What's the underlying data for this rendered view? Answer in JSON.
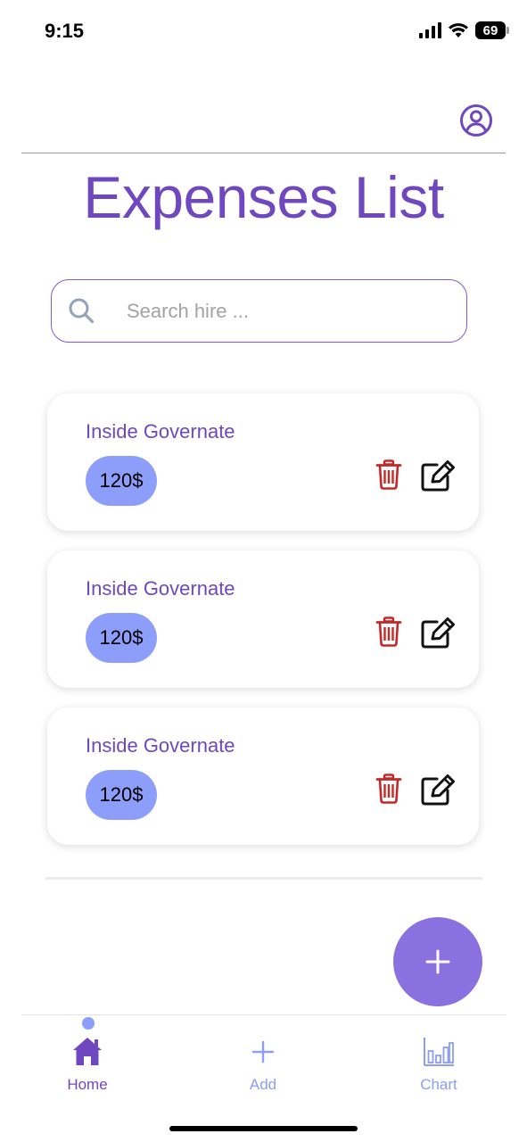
{
  "status_bar": {
    "time": "9:15",
    "battery": "69"
  },
  "header": {
    "title": "Expenses List",
    "profile_icon": "account-circle-icon"
  },
  "search": {
    "placeholder": "Search hire ...",
    "value": "",
    "icon": "search-icon"
  },
  "expenses": [
    {
      "title": "Inside Governate",
      "amount": "120$"
    },
    {
      "title": "Inside Governate",
      "amount": "120$"
    },
    {
      "title": "Inside Governate",
      "amount": "120$"
    }
  ],
  "fab": {
    "icon": "plus-icon"
  },
  "bottom_nav": {
    "items": [
      {
        "label": "Home",
        "icon": "home-icon",
        "active": true
      },
      {
        "label": "Add",
        "icon": "plus-icon",
        "active": false
      },
      {
        "label": "Chart",
        "icon": "bar-chart-icon",
        "active": false
      }
    ]
  },
  "colors": {
    "accent": "#6f48bf",
    "badge": "#8c9dfa",
    "fab": "#8b70e0",
    "delete": "#c62828",
    "nav_inactive": "#8c9dfa"
  }
}
